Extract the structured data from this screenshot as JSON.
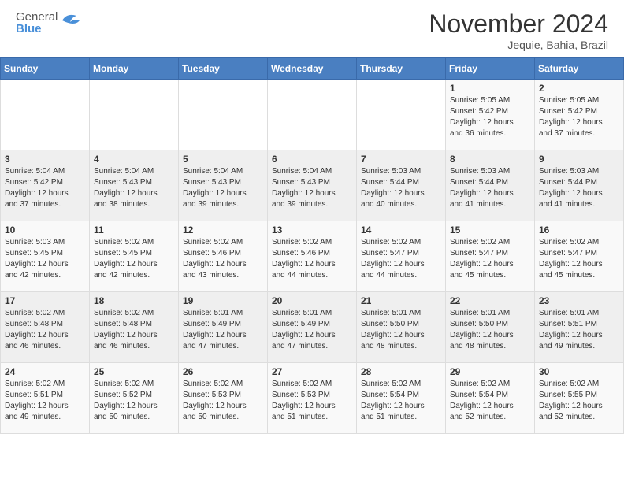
{
  "header": {
    "logo_general": "General",
    "logo_blue": "Blue",
    "month_title": "November 2024",
    "subtitle": "Jequie, Bahia, Brazil"
  },
  "weekdays": [
    "Sunday",
    "Monday",
    "Tuesday",
    "Wednesday",
    "Thursday",
    "Friday",
    "Saturday"
  ],
  "weeks": [
    [
      {
        "day": "",
        "info": ""
      },
      {
        "day": "",
        "info": ""
      },
      {
        "day": "",
        "info": ""
      },
      {
        "day": "",
        "info": ""
      },
      {
        "day": "",
        "info": ""
      },
      {
        "day": "1",
        "info": "Sunrise: 5:05 AM\nSunset: 5:42 PM\nDaylight: 12 hours\nand 36 minutes."
      },
      {
        "day": "2",
        "info": "Sunrise: 5:05 AM\nSunset: 5:42 PM\nDaylight: 12 hours\nand 37 minutes."
      }
    ],
    [
      {
        "day": "3",
        "info": "Sunrise: 5:04 AM\nSunset: 5:42 PM\nDaylight: 12 hours\nand 37 minutes."
      },
      {
        "day": "4",
        "info": "Sunrise: 5:04 AM\nSunset: 5:43 PM\nDaylight: 12 hours\nand 38 minutes."
      },
      {
        "day": "5",
        "info": "Sunrise: 5:04 AM\nSunset: 5:43 PM\nDaylight: 12 hours\nand 39 minutes."
      },
      {
        "day": "6",
        "info": "Sunrise: 5:04 AM\nSunset: 5:43 PM\nDaylight: 12 hours\nand 39 minutes."
      },
      {
        "day": "7",
        "info": "Sunrise: 5:03 AM\nSunset: 5:44 PM\nDaylight: 12 hours\nand 40 minutes."
      },
      {
        "day": "8",
        "info": "Sunrise: 5:03 AM\nSunset: 5:44 PM\nDaylight: 12 hours\nand 41 minutes."
      },
      {
        "day": "9",
        "info": "Sunrise: 5:03 AM\nSunset: 5:44 PM\nDaylight: 12 hours\nand 41 minutes."
      }
    ],
    [
      {
        "day": "10",
        "info": "Sunrise: 5:03 AM\nSunset: 5:45 PM\nDaylight: 12 hours\nand 42 minutes."
      },
      {
        "day": "11",
        "info": "Sunrise: 5:02 AM\nSunset: 5:45 PM\nDaylight: 12 hours\nand 42 minutes."
      },
      {
        "day": "12",
        "info": "Sunrise: 5:02 AM\nSunset: 5:46 PM\nDaylight: 12 hours\nand 43 minutes."
      },
      {
        "day": "13",
        "info": "Sunrise: 5:02 AM\nSunset: 5:46 PM\nDaylight: 12 hours\nand 44 minutes."
      },
      {
        "day": "14",
        "info": "Sunrise: 5:02 AM\nSunset: 5:47 PM\nDaylight: 12 hours\nand 44 minutes."
      },
      {
        "day": "15",
        "info": "Sunrise: 5:02 AM\nSunset: 5:47 PM\nDaylight: 12 hours\nand 45 minutes."
      },
      {
        "day": "16",
        "info": "Sunrise: 5:02 AM\nSunset: 5:47 PM\nDaylight: 12 hours\nand 45 minutes."
      }
    ],
    [
      {
        "day": "17",
        "info": "Sunrise: 5:02 AM\nSunset: 5:48 PM\nDaylight: 12 hours\nand 46 minutes."
      },
      {
        "day": "18",
        "info": "Sunrise: 5:02 AM\nSunset: 5:48 PM\nDaylight: 12 hours\nand 46 minutes."
      },
      {
        "day": "19",
        "info": "Sunrise: 5:01 AM\nSunset: 5:49 PM\nDaylight: 12 hours\nand 47 minutes."
      },
      {
        "day": "20",
        "info": "Sunrise: 5:01 AM\nSunset: 5:49 PM\nDaylight: 12 hours\nand 47 minutes."
      },
      {
        "day": "21",
        "info": "Sunrise: 5:01 AM\nSunset: 5:50 PM\nDaylight: 12 hours\nand 48 minutes."
      },
      {
        "day": "22",
        "info": "Sunrise: 5:01 AM\nSunset: 5:50 PM\nDaylight: 12 hours\nand 48 minutes."
      },
      {
        "day": "23",
        "info": "Sunrise: 5:01 AM\nSunset: 5:51 PM\nDaylight: 12 hours\nand 49 minutes."
      }
    ],
    [
      {
        "day": "24",
        "info": "Sunrise: 5:02 AM\nSunset: 5:51 PM\nDaylight: 12 hours\nand 49 minutes."
      },
      {
        "day": "25",
        "info": "Sunrise: 5:02 AM\nSunset: 5:52 PM\nDaylight: 12 hours\nand 50 minutes."
      },
      {
        "day": "26",
        "info": "Sunrise: 5:02 AM\nSunset: 5:53 PM\nDaylight: 12 hours\nand 50 minutes."
      },
      {
        "day": "27",
        "info": "Sunrise: 5:02 AM\nSunset: 5:53 PM\nDaylight: 12 hours\nand 51 minutes."
      },
      {
        "day": "28",
        "info": "Sunrise: 5:02 AM\nSunset: 5:54 PM\nDaylight: 12 hours\nand 51 minutes."
      },
      {
        "day": "29",
        "info": "Sunrise: 5:02 AM\nSunset: 5:54 PM\nDaylight: 12 hours\nand 52 minutes."
      },
      {
        "day": "30",
        "info": "Sunrise: 5:02 AM\nSunset: 5:55 PM\nDaylight: 12 hours\nand 52 minutes."
      }
    ]
  ]
}
